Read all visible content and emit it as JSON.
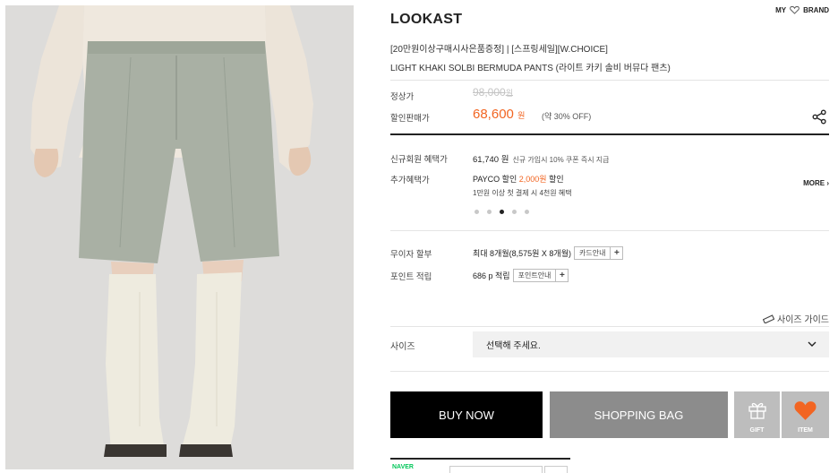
{
  "header": {
    "my_label": "MY",
    "brand_label": "BRAND",
    "heart_icon": "heart-outline-icon"
  },
  "product": {
    "brand": "LOOKAST",
    "promo_line": "[20만원이상구매시사은품증정] | [스프링세일][W.CHOICE]",
    "name": "LIGHT KHAKI SOLBI BERMUDA PANTS (라이트 카키 솔비 버뮤다 팬츠)"
  },
  "price": {
    "regular_label": "정상가",
    "regular_value": "98,000",
    "regular_unit": "원",
    "sale_label": "할인판매가",
    "sale_value": "68,600",
    "sale_unit": "원",
    "sale_note": "(약 30% OFF)",
    "share_icon": "share-icon"
  },
  "benefits": {
    "new_member_label": "신규회원 혜택가",
    "new_member_price": "61,740 원",
    "new_member_note": "신규 가입시 10% 쿠폰 즉시 지급",
    "extra_label": "추가혜택가",
    "payco_prefix": "PAYCO 할인 ",
    "payco_amount": "2,000원",
    "payco_suffix": " 할인",
    "payco_sub": "1만원 이상 첫 결제 시 4천원 혜택",
    "more_label": "MORE ›",
    "carousel_count": 5,
    "carousel_active": 3
  },
  "installment": {
    "label": "무이자 할부",
    "value": "최대 8개월(8,575원 X 8개월)",
    "button_label": "카드안내",
    "plus": "+"
  },
  "points": {
    "label": "포인트 적립",
    "value": "686 p 적립",
    "button_label": "포인트안내",
    "plus": "+"
  },
  "size": {
    "guide_label": "사이즈 가이드",
    "label": "사이즈",
    "placeholder": "선택해 주세요.",
    "guide_icon": "ruler-icon",
    "chevron_icon": "chevron-down-icon"
  },
  "actions": {
    "buy_now": "BUY NOW",
    "shopping_bag": "SHOPPING BAG",
    "gift": "GIFT",
    "item": "ITEM",
    "gift_icon": "gift-icon",
    "item_icon": "heart-filled-icon",
    "item_color": "#f26522"
  },
  "naver": {
    "logo": "NAVER"
  },
  "colors": {
    "accent": "#f26522",
    "buy_bg": "#000000",
    "bag_bg": "#8c8c8c",
    "side_bg": "#bdbdbd"
  }
}
